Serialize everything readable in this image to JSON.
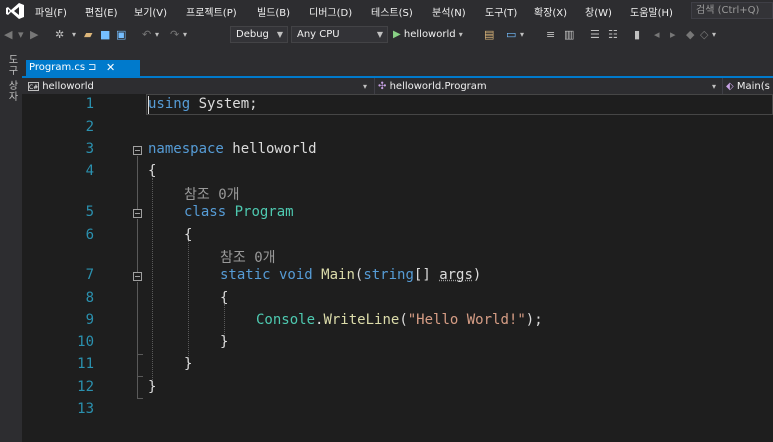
{
  "menubar": {
    "items": [
      "파일(F)",
      "편집(E)",
      "보기(V)",
      "프로젝트(P)",
      "빌드(B)",
      "디버그(D)",
      "테스트(S)",
      "분석(N)",
      "도구(T)",
      "확장(X)",
      "창(W)",
      "도움말(H)"
    ],
    "search_placeholder": "검색 (Ctrl+Q)"
  },
  "toolbar": {
    "config": "Debug",
    "platform": "Any CPU",
    "run_label": "helloworld"
  },
  "toolbox_label": "도구 상자",
  "tab": {
    "label": "Program.cs",
    "pin": "⊐",
    "close": "✕"
  },
  "navbar": {
    "project": "helloworld",
    "class": "helloworld.Program",
    "member": "Main(s"
  },
  "editor": {
    "line_numbers": [
      "1",
      "2",
      "3",
      "4",
      "5",
      "6",
      "7",
      "8",
      "9",
      "10",
      "11",
      "12",
      "13"
    ],
    "ref_hint": "참조 0개",
    "tokens": {
      "using": "using",
      "system": " System;",
      "namespace": "namespace",
      "ns_name": " helloworld",
      "lbrace": "{",
      "rbrace": "}",
      "class": "class",
      "program": " Program",
      "static": "static",
      "void": " void",
      "main": " Main",
      "lparen": "(",
      "string": "string",
      "args_pre": "[] ",
      "args": "args",
      "rparen": ")",
      "console": "Console",
      "dot": ".",
      "writeline": "WriteLine",
      "arg_open": "(",
      "hello": "\"Hello World!\"",
      "arg_close": ");"
    }
  }
}
